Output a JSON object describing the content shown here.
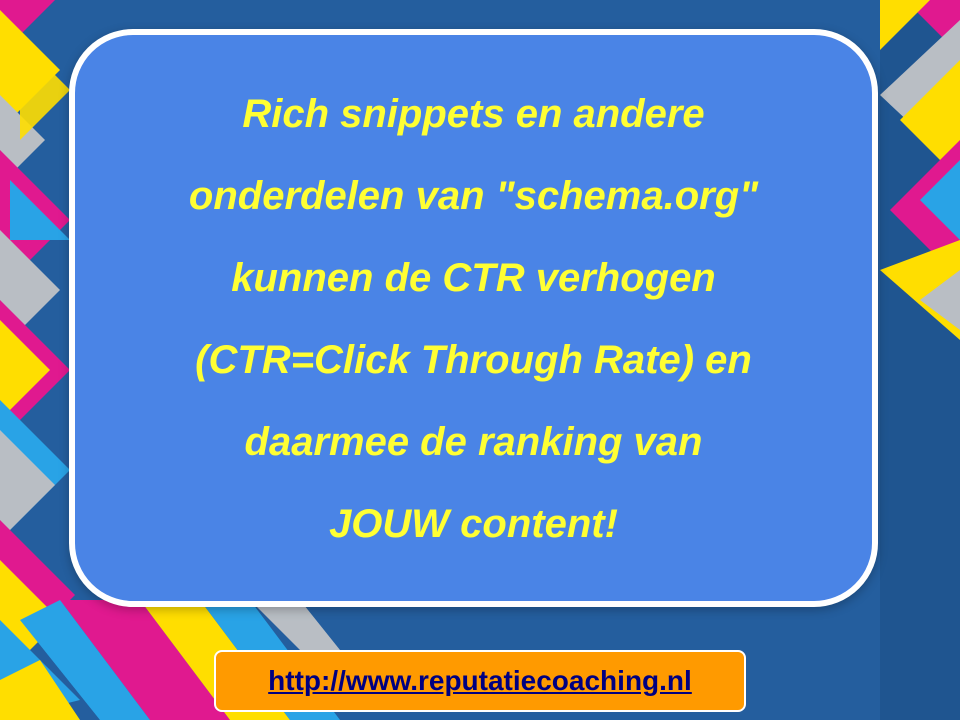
{
  "slide": {
    "message_lines": [
      "Rich snippets en andere",
      "onderdelen van \"schema.org\"",
      "kunnen de CTR verhogen",
      "(CTR=Click Through Rate) en",
      "daarmee de ranking van",
      "JOUW content!"
    ],
    "link_text": "http://www.reputatiecoaching.nl"
  },
  "colors": {
    "background_blue": "#245e9e",
    "card_blue": "#4a84e6",
    "text_yellow": "#ffff33",
    "link_box_orange": "#ff9a00",
    "link_navy": "#000080",
    "accent_magenta": "#e0198f",
    "accent_yellow": "#ffde00",
    "accent_sky": "#29a3e6",
    "accent_grey": "#b9bec4"
  }
}
